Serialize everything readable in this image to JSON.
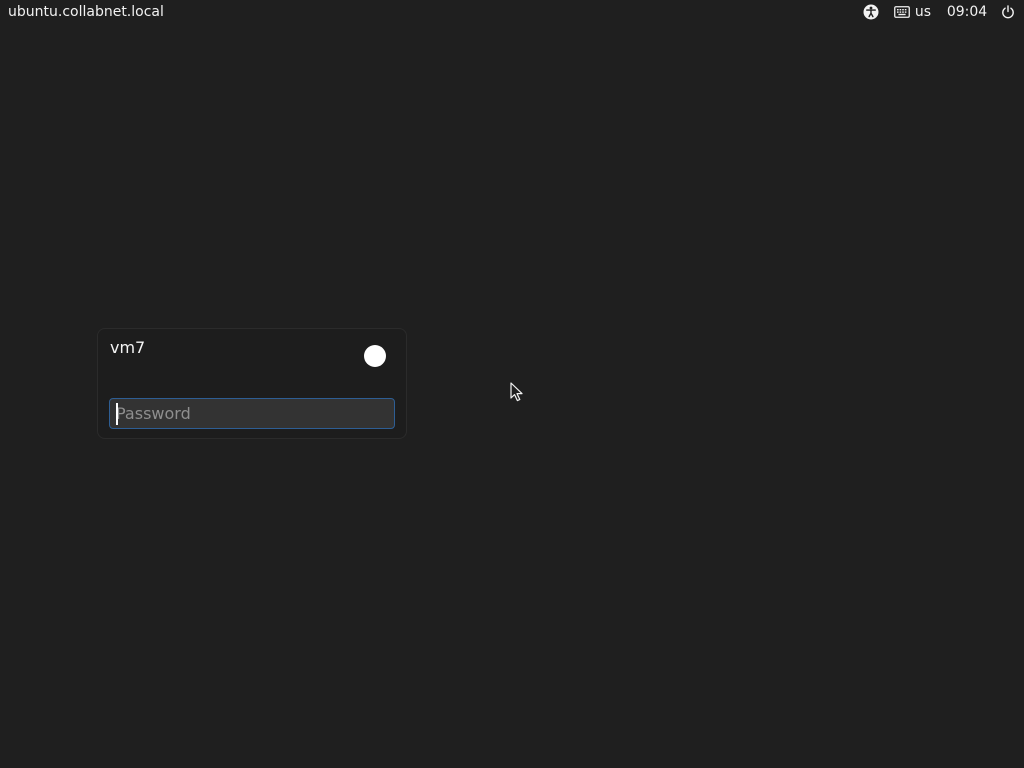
{
  "topbar": {
    "hostname": "ubuntu.collabnet.local",
    "keyboard_layout": "us",
    "clock": "09:04",
    "icons": {
      "accessibility": "accessibility-icon",
      "keyboard": "keyboard-icon",
      "power": "power-icon"
    }
  },
  "login": {
    "username": "vm7",
    "password_value": "",
    "password_placeholder": "Password"
  },
  "colors": {
    "background": "#1f1f1f",
    "card_border": "#2b2b2b",
    "field_background": "#333333",
    "field_focus_border": "#2e5e94",
    "text": "#f2f2f2",
    "placeholder": "#8e8e8e"
  }
}
